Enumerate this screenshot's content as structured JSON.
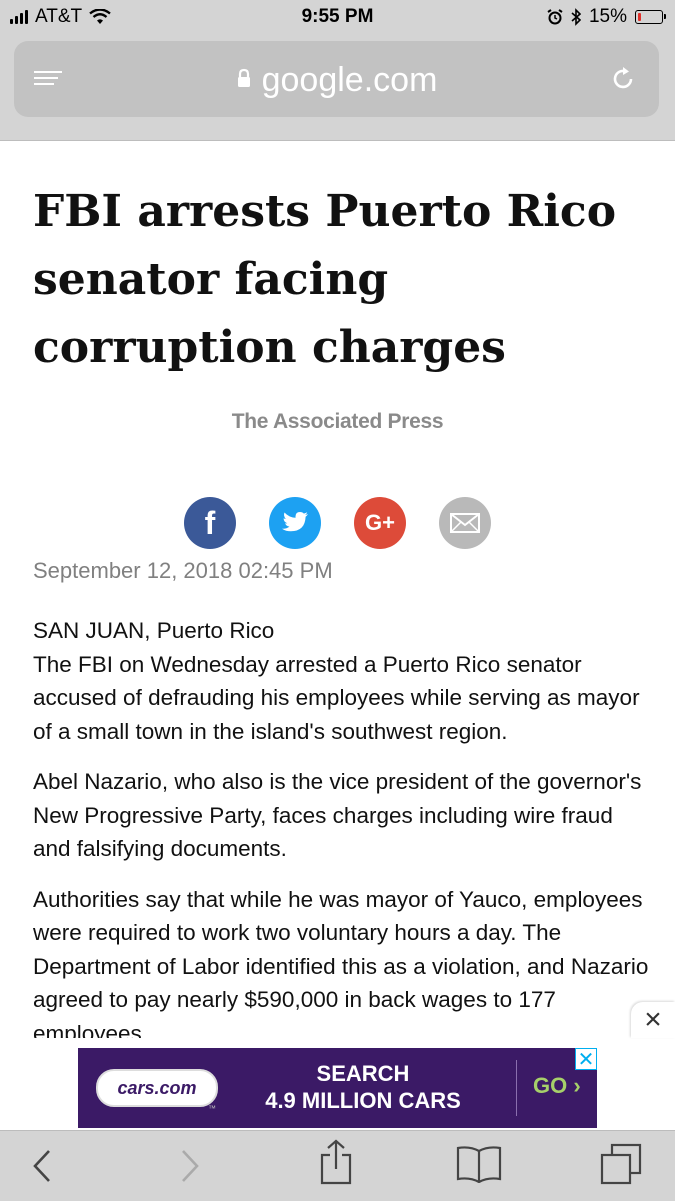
{
  "status_bar": {
    "carrier": "AT&T",
    "time": "9:55 PM",
    "battery_percent": "15%",
    "battery_level": 0.15,
    "icons": [
      "signal-icon",
      "wifi-icon",
      "alarm-icon",
      "bluetooth-icon",
      "battery-icon"
    ]
  },
  "browser": {
    "url": "google.com",
    "icons": [
      "menu-icon",
      "lock-icon",
      "reload-icon"
    ]
  },
  "article": {
    "headline": "FBI arrests Puerto Rico senator facing corruption charges",
    "byline": "The Associated Press",
    "share_buttons": [
      {
        "name": "facebook",
        "label": "f"
      },
      {
        "name": "twitter",
        "label": ""
      },
      {
        "name": "google-plus",
        "label": "G+"
      },
      {
        "name": "email",
        "label": ""
      }
    ],
    "date": "September 12, 2018 02:45 PM",
    "location": "SAN JUAN, Puerto Rico",
    "paragraphs": [
      "The FBI on Wednesday arrested a Puerto Rico senator accused of defrauding his employees while serving as mayor of a small town in the island's southwest region.",
      "Abel Nazario, who also is the vice president of the governor's New Progressive Party, faces charges including wire fraud and falsifying documents.",
      "Authorities say that while he was mayor of Yauco, employees were required to work two voluntary hours a day. The Department of Labor identified this as a violation, and Nazario agreed to pay nearly $590,000 in back wages to 177 employees."
    ]
  },
  "ad": {
    "logo_text": "cars.com",
    "trademark": "™",
    "line1": "SEARCH",
    "line2": "4.9 MILLION CARS",
    "cta": "GO ›",
    "close_label": "×",
    "ad_close_label": "✕",
    "colors": {
      "background": "#3b1a66",
      "cta": "#a6d06a"
    }
  },
  "toolbar": {
    "buttons": [
      "back",
      "forward",
      "share",
      "bookmarks",
      "tabs"
    ]
  }
}
